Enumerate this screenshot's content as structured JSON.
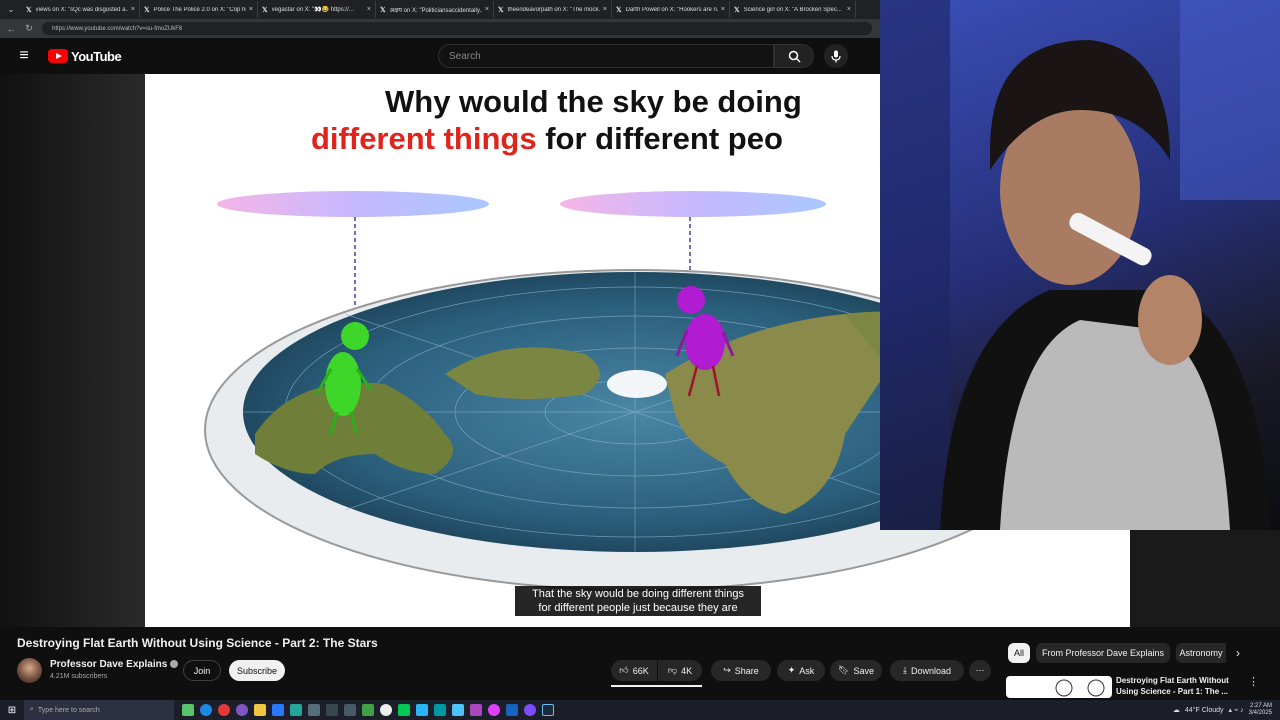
{
  "browser": {
    "tabs": [
      {
        "label": "views on X: \"sQc was disgusted a..."
      },
      {
        "label": "Police The Police 2.0 on X: \"Cop hi..."
      },
      {
        "label": "vegastar on X: \"👀😂 https://..."
      },
      {
        "label": "अक्षय on X: \"Politiciansaccidentally..."
      },
      {
        "label": "theendeavorpath on X: \"The mock..."
      },
      {
        "label": "Darth Powell on X: \"Hookers are n..."
      },
      {
        "label": "Science girl on X: \"A Brocken Spec..."
      }
    ],
    "url": "https://www.youtube.com/watch?v=su-fmoZUkF8"
  },
  "header": {
    "logo_text": "YouTube",
    "search_placeholder": "Search"
  },
  "video": {
    "headline_line1": "Why would the sky be doing",
    "headline_line2_red": "different things",
    "headline_line2_rest": " for different peo",
    "caption_line1": "That the sky would be doing different things",
    "caption_line2": "for different people just because they are"
  },
  "details": {
    "title": "Destroying Flat Earth Without Using Science - Part 2: The Stars",
    "channel": "Professor Dave Explains",
    "subscribers": "4.21M subscribers",
    "join_label": "Join",
    "subscribe_label": "Subscribe",
    "likes": "66K",
    "dislikes": "4K",
    "share_label": "Share",
    "ask_label": "Ask",
    "save_label": "Save",
    "download_label": "Download"
  },
  "sidebar": {
    "chips": [
      "All",
      "From Professor Dave Explains",
      "Astronomy"
    ],
    "recommended_title": "Destroying Flat Earth Without Using Science - Part 1: The ..."
  },
  "taskbar": {
    "search_placeholder": "Type here to search",
    "weather": "44°F Cloudy",
    "time": "2:27 AM",
    "date": "3/4/2025"
  }
}
